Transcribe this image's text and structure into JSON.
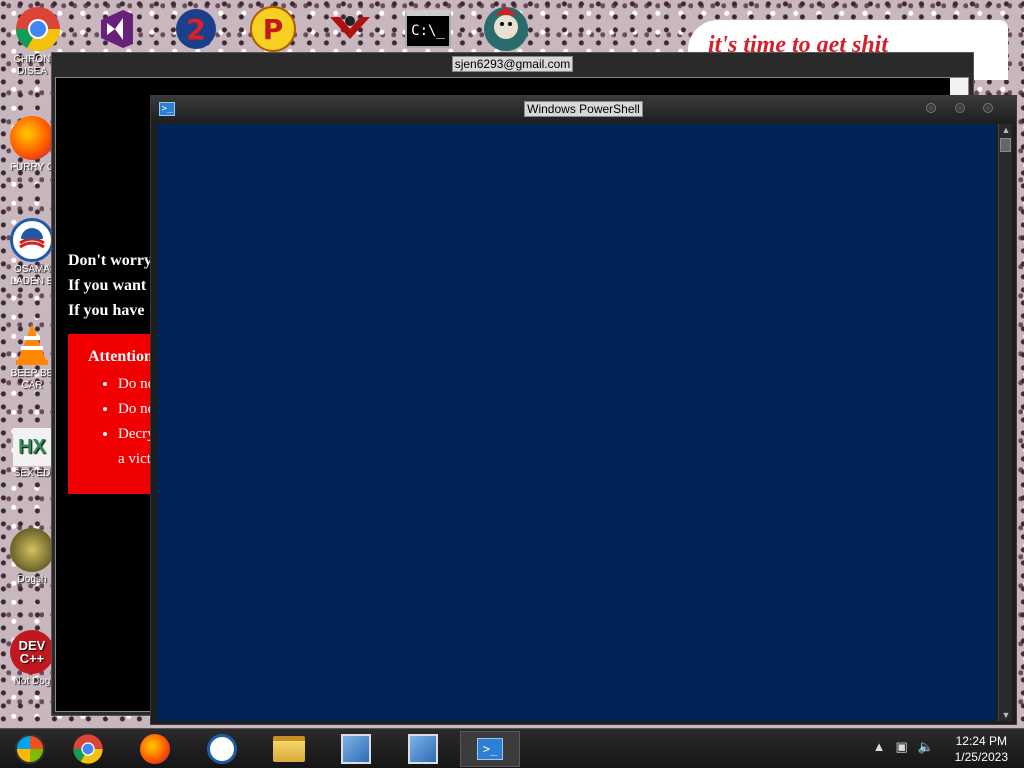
{
  "desktop": {
    "left_icons": [
      {
        "label": "CHRON DISEA",
        "icon": "chrome-icon",
        "color": "#e0a000"
      },
      {
        "label": "FURRY C",
        "icon": "firefox-icon",
        "color": "#ff7a00"
      },
      {
        "label": "OSAMA LADEN E",
        "icon": "obama-logo-icon",
        "color": "#1f5aa8"
      },
      {
        "label": "BEEP BE CAR",
        "icon": "vlc-cone-icon",
        "color": "#ff8800"
      },
      {
        "label": "SEX ED",
        "icon": "hx-icon",
        "color": "#2e8b57"
      },
      {
        "label": "Dogsh",
        "icon": "dogsh-icon",
        "color": "#3a3a10"
      },
      {
        "label": "Not Dog",
        "icon": "devcpp-icon",
        "color": "#c0181e"
      }
    ],
    "top_icons": [
      "visual-studio-icon",
      "game-2-icon",
      "p-icon",
      "red-emblem-icon",
      "cmd-icon",
      "seal-app-icon"
    ],
    "wallpaper_text": "it's time to get shit"
  },
  "back_window": {
    "title": "sjen6293@gmail.com",
    "lines": [
      "Don't worry",
      "If you want",
      "If you have"
    ],
    "attention_title": "Attention",
    "bullets": [
      "Do no",
      "Do no",
      "Decry"
    ],
    "bullet_cont": "a vict"
  },
  "powershell": {
    "title": "Windows PowerShell",
    "app_icon_glyph": ">_",
    "background": "#012456"
  },
  "taskbar": {
    "items": [
      {
        "name": "start-button",
        "icon": "start-orb-icon"
      },
      {
        "name": "taskbar-chrome",
        "icon": "chrome-icon"
      },
      {
        "name": "taskbar-firefox",
        "icon": "firefox-icon"
      },
      {
        "name": "taskbar-obama",
        "icon": "obama-logo-icon"
      },
      {
        "name": "taskbar-explorer",
        "icon": "folder-icon"
      },
      {
        "name": "taskbar-network-1",
        "icon": "network-setup-icon"
      },
      {
        "name": "taskbar-network-2",
        "icon": "network-setup-icon"
      },
      {
        "name": "taskbar-powershell",
        "icon": "powershell-icon",
        "active": true
      }
    ],
    "clock_time": "12:24 PM",
    "clock_date": "1/25/2023"
  }
}
